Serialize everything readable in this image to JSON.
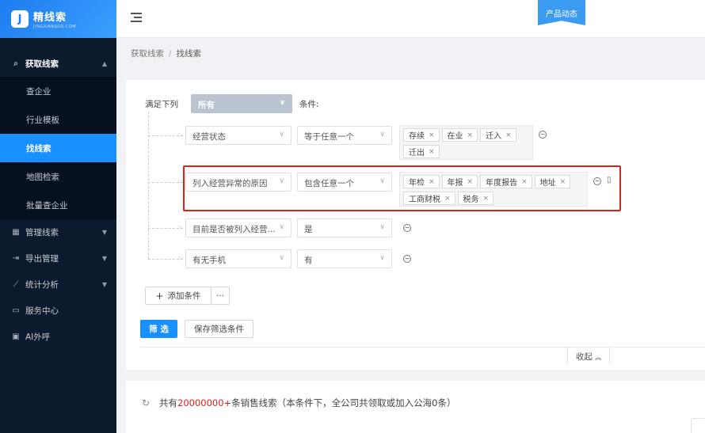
{
  "brand": {
    "name": "精线索",
    "sub": "JINGXIANSUO.COM"
  },
  "sidebar": {
    "group_acquire": "获取线索",
    "sub_items": [
      "查企业",
      "行业模板",
      "找线索",
      "地图检索",
      "批量查企业"
    ],
    "items": [
      "管理线索",
      "导出管理",
      "统计分析",
      "服务中心",
      "AI外呼"
    ]
  },
  "header": {
    "product_news": "产品动态"
  },
  "breadcrumb": {
    "parent": "获取线索",
    "sep": "/",
    "current": "找线索"
  },
  "filter": {
    "match_label": "满足下列",
    "match_value": "所有",
    "conditions_label": "条件:",
    "rows": [
      {
        "field": "经营状态",
        "op": "等于任意一个",
        "tags": [
          "存续",
          "在业",
          "迁入",
          "迁出"
        ]
      },
      {
        "field": "列入经营异常的原因",
        "op": "包含任意一个",
        "tags": [
          "年检",
          "年报",
          "年度报告",
          "地址",
          "工商财税",
          "税务"
        ]
      },
      {
        "field": "目前是否被列入经营...",
        "op": "是"
      },
      {
        "field": "有无手机",
        "op": "有"
      }
    ],
    "add_condition": "添加条件",
    "more": "···",
    "filter_btn": "筛 选",
    "save_btn": "保存筛选条件",
    "collapse": "收起"
  },
  "results": {
    "prefix": "共有",
    "count": "20000000+",
    "suffix": "条销售线索（本条件下，全公司共领取或加入公海0条）"
  },
  "colors": {
    "primary": "#1890ff",
    "sidebar_bg": "#0b1a2c",
    "highlight": "#e0201a"
  }
}
